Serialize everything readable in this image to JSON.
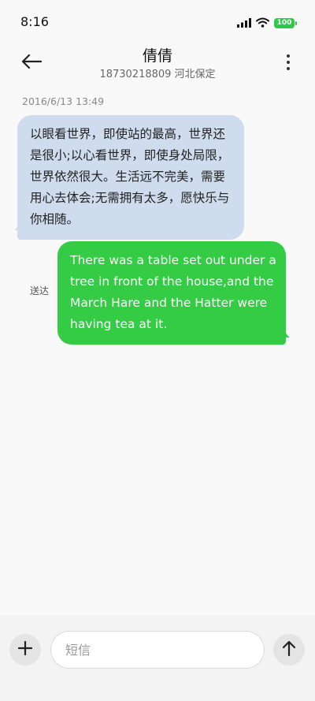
{
  "status_bar": {
    "time": "8:16",
    "battery": "100",
    "icons": [
      "signal-icon",
      "wifi-icon",
      "battery-icon"
    ]
  },
  "header": {
    "name": "倩倩",
    "subtitle": "18730218809 河北保定",
    "icons": [
      "back-arrow-icon",
      "more-vertical-icon"
    ]
  },
  "conversation": {
    "timestamp": "2016/6/13 13:49",
    "messages": [
      {
        "direction": "incoming",
        "text": "以眼看世界，即使站的最高，世界还是很小;以心看世界，即使身处局限，世界依然很大。生活远不完美，需要用心去体会;无需拥有太多，愿快乐与你相随。"
      },
      {
        "direction": "outgoing",
        "text": "There was a table set out under a tree in front of the house,and the March Hare and the Hatter were having tea at it.",
        "status": "送达"
      }
    ]
  },
  "composer": {
    "placeholder": "短信",
    "value": "",
    "icons": [
      "plus-icon",
      "send-arrow-icon"
    ]
  },
  "colors": {
    "incoming_bubble": "#cfdced",
    "outgoing_bubble": "#33cc44",
    "battery": "#2fc94a"
  }
}
